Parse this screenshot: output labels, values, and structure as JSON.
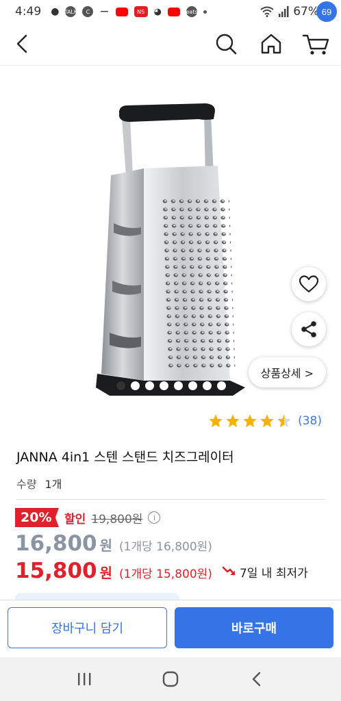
{
  "status_bar": {
    "time": "4:49",
    "battery": "67%",
    "notification_icons": [
      "kakao-icon",
      "talk-icon",
      "c-icon",
      "minus-icon",
      "youtube-icon",
      "ns-icon",
      "bowl-icon",
      "youtube-icon",
      "coupang-eats-icon",
      "dot-icon"
    ],
    "notif_talk": "TALK",
    "notif_c": "C",
    "notif_ns": "NS",
    "notif_eats": "eats"
  },
  "nav": {
    "cart_count": "69"
  },
  "gallery": {
    "image_count": 8,
    "active_index": 0,
    "detail_button": "상품상세 >"
  },
  "rating": {
    "stars": 4.5,
    "count": "(38)"
  },
  "product": {
    "title": "JANNA 4in1 스텐 스탠드 치즈그레이터",
    "quantity_label": "수량",
    "quantity_value": "1개"
  },
  "pricing": {
    "discount_badge": "20%",
    "discount_label": "할인",
    "original_price": "19,800원",
    "price": "16,800",
    "price_won": "원",
    "price_unit": "(1개당 16,800원)",
    "sale_price": "15,800",
    "sale_won": "원",
    "sale_unit": "(1개당 15,800원)",
    "lowest_label": "7일 내 최저가"
  },
  "actions": {
    "add_to_cart": "장바구니 담기",
    "buy_now": "바로구매"
  },
  "colors": {
    "accent": "#3474e6",
    "sale": "#e0202a",
    "star": "#f5b301"
  }
}
